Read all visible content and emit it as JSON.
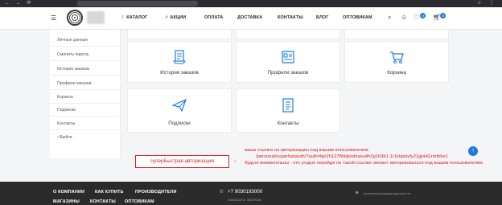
{
  "header": {
    "nav": [
      "КАТАЛОГ",
      "АКЦИИ",
      "ОПЛАТА",
      "ДОСТАВКА",
      "КОНТАКТЫ",
      "БЛОГ",
      "ОПТОВИКАМ"
    ],
    "favorites_count": "0",
    "cart_count": "0"
  },
  "sidebar": {
    "items": [
      "Личные данные",
      "Сменить пароль",
      "История заказов",
      "Профили заказов",
      "Корзина",
      "Подписки",
      "Контакты",
      "Выйти"
    ]
  },
  "cards": [
    {
      "label": "История заказов",
      "icon": "order-history-icon"
    },
    {
      "label": "Профили заказов",
      "icon": "order-profiles-icon"
    },
    {
      "label": "Корзина",
      "icon": "cart-icon"
    },
    {
      "label": "Подписки",
      "icon": "subscriptions-icon"
    },
    {
      "label": "Контакты",
      "icon": "contacts-icon"
    }
  ],
  "note": {
    "button": "суперБыстрая авторизация",
    "line1": "ваша ссылка на авторизацию под вашим пользователем:",
    "line2": "/personal/superfastauth/?auth=kjn2h1278hkjksdoasu4h2g1h3b1-1r1kkjdsyfy21jjjvHGrmtbbe1",
    "line3": "будьте внимательны - кто угодно перейдя по такой ссылке сможет авторизоваться под вашим пользователем"
  },
  "footer": {
    "links_row1": [
      "О КОМПАНИИ",
      "КАК КУПИТЬ",
      "ПРОИЗВОДИТЕЛИ"
    ],
    "links_row2": [
      "МАГАЗИНЫ",
      "КОНТАКТЫ",
      "ОПТОВИКАМ"
    ],
    "phone": "+7 9030193000",
    "callback": "ЗАКАЗАТЬ ЗВОНОК",
    "policy": "политика конфиденциальности"
  },
  "colors": {
    "accent": "#1f7ae0",
    "alert": "#e01a1a",
    "footer": "#2b2b2b"
  }
}
